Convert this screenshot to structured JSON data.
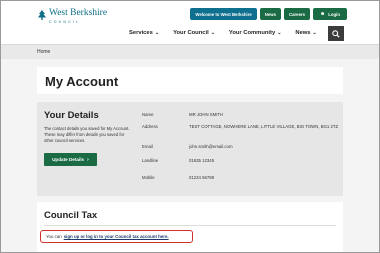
{
  "header": {
    "logo_text": "West Berkshire",
    "logo_sub": "COUNCIL",
    "top_buttons": {
      "welcome": "Welcome to West Berkshire",
      "news": "News",
      "careers": "Careers",
      "login": "Login"
    },
    "nav": {
      "services": "Services",
      "your_council": "Your Council",
      "your_community": "Your Community",
      "news": "News"
    },
    "colors": {
      "brand": "#0f6f8e",
      "green": "#1a6b44"
    }
  },
  "breadcrumb": {
    "home": "Home"
  },
  "page": {
    "title": "My Account"
  },
  "details": {
    "heading": "Your Details",
    "description": "The contact details you saved for My Account. These may differ from details you saved for other council services.",
    "update_button": "Update Details",
    "rows": {
      "name_label": "Name",
      "name_value": "MR JOHN SMITH",
      "address_label": "Address",
      "address_value": "TEST COTTAGE, NOWHERE LANE, LITTLE VILLAGE, BIG TOWN, BG1 2TZ",
      "email_label": "Email",
      "email_value": "john.smith@email.com",
      "landline_label": "Landline",
      "landline_value": "01635 12345",
      "mobile_label": "Mobile",
      "mobile_value": "01234 56789"
    }
  },
  "council_tax": {
    "heading": "Council Tax",
    "prefix": "You can",
    "link": "sign up or log in to your Council tax account here."
  }
}
